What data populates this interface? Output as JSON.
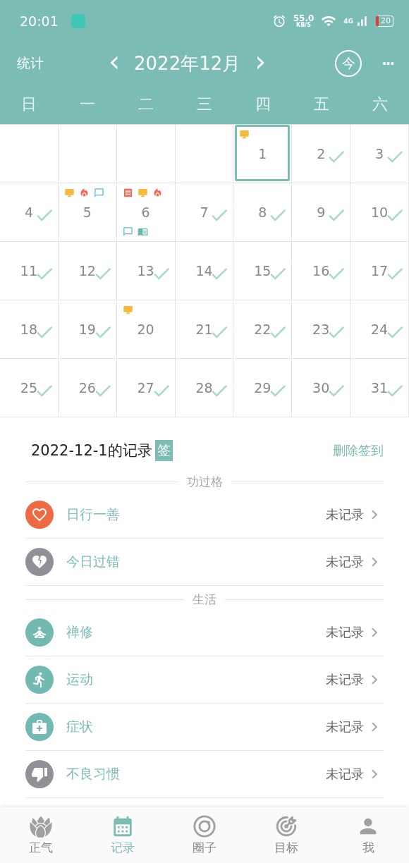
{
  "status_bar": {
    "time": "20:01",
    "speed": "55.0",
    "speed_unit": "KB/S",
    "network": "4G",
    "battery": "20"
  },
  "header": {
    "left": "统计",
    "prev": "‹",
    "title": "2022年12月",
    "next": "›",
    "today": "今",
    "more": "···"
  },
  "weekdays": [
    "日",
    "一",
    "二",
    "三",
    "四",
    "五",
    "六"
  ],
  "weeks": [
    [
      {
        "kind": "blank"
      },
      {
        "kind": "blank"
      },
      {
        "kind": "blank"
      },
      {
        "kind": "blank"
      },
      {
        "kind": "day",
        "label": "1",
        "checked": false,
        "selected": true,
        "marks_top": [
          {
            "kind": "monitor"
          }
        ]
      },
      {
        "kind": "day",
        "label": "2",
        "checked": true,
        "selected": false
      },
      {
        "kind": "day",
        "label": "3",
        "checked": true,
        "selected": false
      }
    ],
    [
      {
        "kind": "day",
        "label": "4",
        "checked": true,
        "selected": false
      },
      {
        "kind": "day",
        "label": "5",
        "checked": false,
        "selected": false,
        "marks_top": [
          {
            "kind": "monitor"
          },
          {
            "kind": "fire"
          },
          {
            "kind": "chat"
          }
        ]
      },
      {
        "kind": "day",
        "label": "6",
        "checked": false,
        "selected": false,
        "marks_top": [
          {
            "kind": "scroll"
          },
          {
            "kind": "monitor"
          },
          {
            "kind": "fire"
          }
        ],
        "marks_bottom": [
          {
            "kind": "chat"
          },
          {
            "kind": "book"
          }
        ]
      },
      {
        "kind": "day",
        "label": "7",
        "checked": true,
        "selected": false
      },
      {
        "kind": "day",
        "label": "8",
        "checked": true,
        "selected": false
      },
      {
        "kind": "day",
        "label": "9",
        "checked": true,
        "selected": false
      },
      {
        "kind": "day",
        "label": "10",
        "checked": true,
        "selected": false
      }
    ],
    [
      {
        "kind": "day",
        "label": "11",
        "checked": true,
        "selected": false
      },
      {
        "kind": "day",
        "label": "12",
        "checked": true,
        "selected": false
      },
      {
        "kind": "day",
        "label": "13",
        "checked": true,
        "selected": false
      },
      {
        "kind": "day",
        "label": "14",
        "checked": true,
        "selected": false
      },
      {
        "kind": "day",
        "label": "15",
        "checked": true,
        "selected": false
      },
      {
        "kind": "day",
        "label": "16",
        "checked": true,
        "selected": false
      },
      {
        "kind": "day",
        "label": "17",
        "checked": true,
        "selected": false
      }
    ],
    [
      {
        "kind": "day",
        "label": "18",
        "checked": true,
        "selected": false
      },
      {
        "kind": "day",
        "label": "19",
        "checked": true,
        "selected": false
      },
      {
        "kind": "day",
        "label": "20",
        "checked": false,
        "selected": false,
        "marks_top": [
          {
            "kind": "monitor"
          }
        ]
      },
      {
        "kind": "day",
        "label": "21",
        "checked": true,
        "selected": false
      },
      {
        "kind": "day",
        "label": "22",
        "checked": true,
        "selected": false
      },
      {
        "kind": "day",
        "label": "23",
        "checked": true,
        "selected": false
      },
      {
        "kind": "day",
        "label": "24",
        "checked": true,
        "selected": false
      }
    ],
    [
      {
        "kind": "day",
        "label": "25",
        "checked": true,
        "selected": false
      },
      {
        "kind": "day",
        "label": "26",
        "checked": true,
        "selected": false
      },
      {
        "kind": "day",
        "label": "27",
        "checked": true,
        "selected": false
      },
      {
        "kind": "day",
        "label": "28",
        "checked": true,
        "selected": false
      },
      {
        "kind": "day",
        "label": "29",
        "checked": true,
        "selected": false
      },
      {
        "kind": "day",
        "label": "30",
        "checked": true,
        "selected": false
      },
      {
        "kind": "day",
        "label": "31",
        "checked": true,
        "selected": false
      }
    ]
  ],
  "record": {
    "title": "2022-12-1的记录",
    "badge": "签",
    "action": "删除签到"
  },
  "sections": [
    {
      "title": "功过格",
      "items": [
        {
          "kind": "heart",
          "label": "日行一善",
          "status": "未记录",
          "color": "#ee6a42"
        },
        {
          "kind": "broken-heart",
          "label": "今日过错",
          "status": "未记录",
          "color": "#8f9196"
        }
      ]
    },
    {
      "title": "生活",
      "items": [
        {
          "kind": "meditation",
          "label": "禅修",
          "status": "未记录",
          "color": "#72b9b1"
        },
        {
          "kind": "running",
          "label": "运动",
          "status": "未记录",
          "color": "#72b9b1"
        },
        {
          "kind": "medkit",
          "label": "症状",
          "status": "未记录",
          "color": "#72b9b1"
        },
        {
          "kind": "thumbs-down",
          "label": "不良习惯",
          "status": "未记录",
          "color": "#8f9196"
        }
      ]
    }
  ],
  "tabs": [
    {
      "kind": "lotus",
      "label": "正气",
      "selected": false
    },
    {
      "kind": "calendar",
      "label": "记录",
      "selected": true
    },
    {
      "kind": "circle",
      "label": "圈子",
      "selected": false
    },
    {
      "kind": "target",
      "label": "目标",
      "selected": false
    },
    {
      "kind": "person",
      "label": "我",
      "selected": false
    }
  ]
}
